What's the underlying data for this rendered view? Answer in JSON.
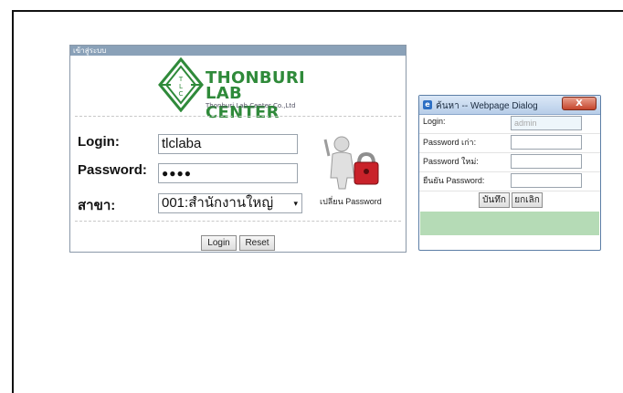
{
  "login_panel": {
    "title": "เข้าสู่ระบบ",
    "logo": {
      "line1": "THONBURI",
      "line2": "LAB CENTER",
      "sub": "Thonburi Lab Center Co.,Ltd",
      "emblem_letters": "TLC"
    },
    "login_label": "Login:",
    "login_value": "tlclaba",
    "password_label": "Password:",
    "password_value": "●●●●",
    "branch_label": "สาขา:",
    "branch_value": "001:สำนักงานใหญ่",
    "change_password_label": "เปลี่ยน Password",
    "login_button": "Login",
    "reset_button": "Reset"
  },
  "dialog": {
    "title": "ค้นหา -- Webpage Dialog",
    "close_label": "X",
    "rows": [
      {
        "label": "Login:",
        "value": "admin"
      },
      {
        "label": "Password เก่า:",
        "value": ""
      },
      {
        "label": "Password ใหม่:",
        "value": ""
      },
      {
        "label": "ยืนยัน Password:",
        "value": ""
      }
    ],
    "save_button": "บันทึก",
    "cancel_button": "ยกเลิก"
  },
  "colors": {
    "brand_green": "#2f8a3a",
    "panel_header": "#8aa1b8",
    "dialog_status": "#b5dbb6"
  }
}
